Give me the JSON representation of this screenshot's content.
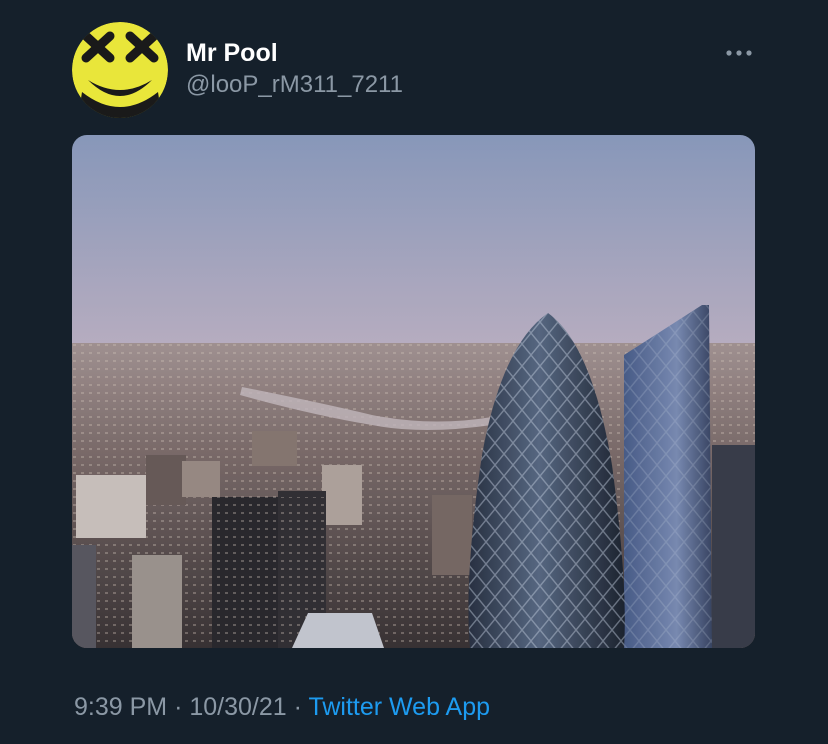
{
  "user": {
    "display_name": "Mr Pool",
    "handle": "@looP_rM311_7211",
    "avatar_icon": "yellow-smiley-x-eyes-icon"
  },
  "actions": {
    "more_icon": "more-horizontal-icon"
  },
  "media": {
    "type": "photo"
  },
  "meta": {
    "time": "9:39 PM",
    "separator": "·",
    "date": "10/30/21",
    "source": "Twitter Web App"
  },
  "colors": {
    "background": "#15202b",
    "primary_text": "#ffffff",
    "secondary_text": "#8b98a5",
    "link": "#1d9bf0",
    "avatar_yellow": "#e9e63a"
  }
}
